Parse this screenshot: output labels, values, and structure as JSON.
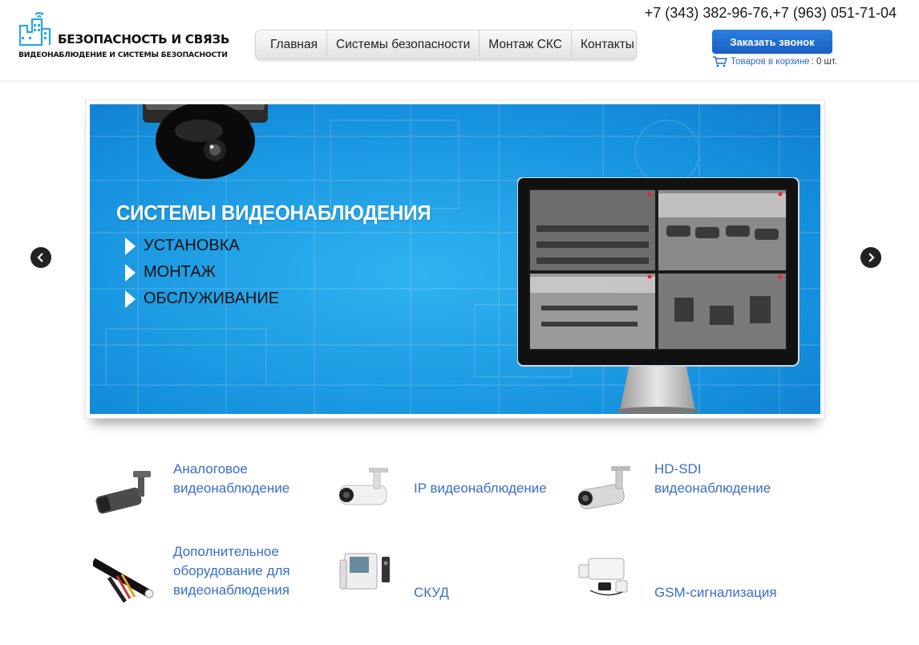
{
  "header": {
    "logo_title": "БЕЗОПАСНОСТЬ И СВЯЗЬ",
    "logo_subtitle": "ВИДЕОНАБЛЮДЕНИЕ И СИСТЕМЫ БЕЗОПАСНОСТИ",
    "phone": "+7 (343) 382-96-76,+7 (963) 051-71-04",
    "callback_label": "Заказать звонок",
    "cart_label": "Товаров в корзине",
    "cart_count": ": 0 шт."
  },
  "nav": {
    "items": [
      "Главная",
      "Системы безопасности",
      "Монтаж СКС",
      "Контакты"
    ]
  },
  "slider": {
    "title": "СИСТЕМЫ ВИДЕОНАБЛЮДЕНИЯ",
    "bullets": [
      "УСТАНОВКА",
      "МОНТАЖ",
      "ОБСЛУЖИВАНИЕ"
    ],
    "prev_icon": "chevron-left-icon",
    "next_icon": "chevron-right-icon"
  },
  "products": [
    {
      "name": "Аналоговое видеонаблюдение",
      "icon": "analog-camera-icon"
    },
    {
      "name": "IP видеонаблюдение",
      "icon": "ip-camera-icon"
    },
    {
      "name": "HD-SDI видеонаблюдение",
      "icon": "hdsdi-camera-icon"
    },
    {
      "name": "Дополнительное оборудование для видеонаблюдения",
      "icon": "cable-icon"
    },
    {
      "name": "СКУД",
      "icon": "intercom-icon"
    },
    {
      "name": "GSM-сигнализация",
      "icon": "gsm-alarm-icon"
    }
  ],
  "colors": {
    "accent": "#1a6fd6",
    "link": "#3b6dc8",
    "slide_bg": "#1a9ae6"
  }
}
